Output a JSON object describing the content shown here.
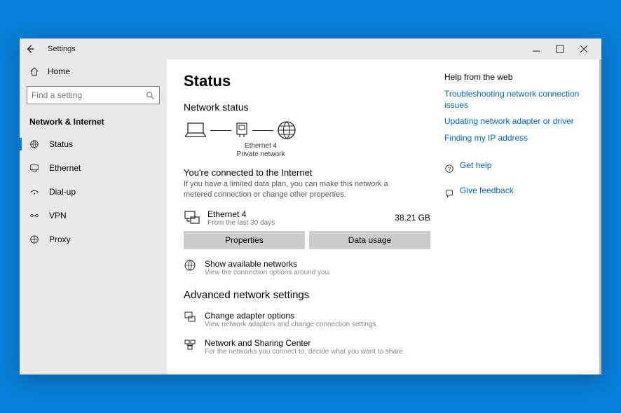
{
  "app": {
    "name": "Settings"
  },
  "sidebar": {
    "home": "Home",
    "search_placeholder": "Find a setting",
    "section": "Network & Internet",
    "items": [
      {
        "label": "Status"
      },
      {
        "label": "Ethernet"
      },
      {
        "label": "Dial-up"
      },
      {
        "label": "VPN"
      },
      {
        "label": "Proxy"
      }
    ]
  },
  "page": {
    "title": "Status",
    "subheading": "Network status",
    "diagram": {
      "adapter": "Ethernet 4",
      "profile": "Private network"
    },
    "connected_title": "You're connected to the Internet",
    "connected_desc": "If you have a limited data plan, you can make this network a metered connection or change other properties.",
    "adapter": {
      "name": "Ethernet 4",
      "sub": "From the last 30 days",
      "usage": "38.21 GB"
    },
    "buttons": {
      "properties": "Properties",
      "data_usage": "Data usage"
    },
    "show_networks": {
      "title": "Show available networks",
      "desc": "View the connection options around you."
    },
    "advanced_heading": "Advanced network settings",
    "adapter_options": {
      "title": "Change adapter options",
      "desc": "View network adapters and change connection settings."
    },
    "sharing_center": {
      "title": "Network and Sharing Center",
      "desc": "For the networks you connect to, decide what you want to share."
    }
  },
  "help": {
    "heading": "Help from the web",
    "links": [
      "Troubleshooting network connection issues",
      "Updating network adapter or driver",
      "Finding my IP address"
    ],
    "get_help": "Get help",
    "feedback": "Give feedback"
  }
}
